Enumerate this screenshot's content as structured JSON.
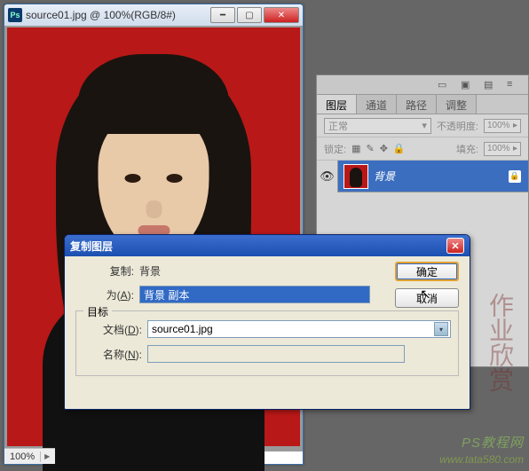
{
  "doc": {
    "title": "source01.jpg @ 100%(RGB/8#)",
    "zoom": "100%"
  },
  "panel": {
    "tabs": [
      "图层",
      "通道",
      "路径",
      "调整"
    ],
    "blend_mode": "正常",
    "opacity_label": "不透明度:",
    "opacity_value": "100%",
    "lock_label": "锁定:",
    "fill_label": "填充:",
    "fill_value": "100%",
    "layer": {
      "name": "背景"
    }
  },
  "dialog": {
    "title": "复制图层",
    "copy_label": "复制:",
    "copy_value": "背景",
    "as_label": "为(A):",
    "as_value": "背景 副本",
    "target_legend": "目标",
    "doc_label": "文档(D):",
    "doc_value": "source01.jpg",
    "name_label": "名称(N):",
    "name_value": "",
    "ok": "确定",
    "cancel": "取消"
  },
  "watermark": {
    "line1": "PS教程网",
    "line2": "www.tata580.com"
  }
}
